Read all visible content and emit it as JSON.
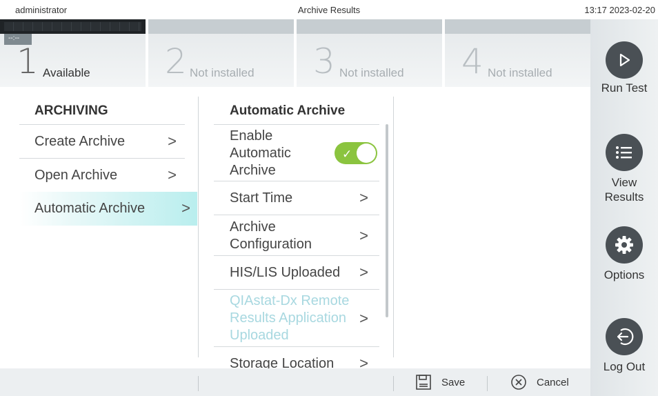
{
  "topbar": {
    "user": "administrator",
    "title": "Archive Results",
    "datetime": "13:17 2023-02-20"
  },
  "modules": [
    {
      "number": "1",
      "status": "Available",
      "tag": "--:--"
    },
    {
      "number": "2",
      "status": "Not installed"
    },
    {
      "number": "3",
      "status": "Not installed"
    },
    {
      "number": "4",
      "status": "Not installed"
    }
  ],
  "sidebar": {
    "run_test": "Run Test",
    "view_results_line1": "View",
    "view_results_line2": "Results",
    "options": "Options",
    "log_out": "Log Out"
  },
  "archiving": {
    "heading": "ARCHIVING",
    "items": [
      {
        "label": "Create Archive",
        "selected": false
      },
      {
        "label": "Open Archive",
        "selected": false
      },
      {
        "label": "Automatic Archive",
        "selected": true
      }
    ]
  },
  "automatic_archive": {
    "heading": "Automatic Archive",
    "enable_line1": "Enable",
    "enable_line2": "Automatic",
    "enable_line3": "Archive",
    "enabled": true,
    "start_time": "Start Time",
    "archive_config_line1": "Archive",
    "archive_config_line2": "Configuration",
    "his_lis": "HIS/LIS Uploaded",
    "remote_line1": "QIAstat-Dx Remote",
    "remote_line2": "Results Application",
    "remote_line3": "Uploaded",
    "storage_location": "Storage Location"
  },
  "bottombar": {
    "save": "Save",
    "cancel": "Cancel"
  },
  "colors": {
    "toggle_on": "#8bc43f",
    "selected_row": "#b9eeee",
    "sidebar_button": "#4a5055"
  }
}
